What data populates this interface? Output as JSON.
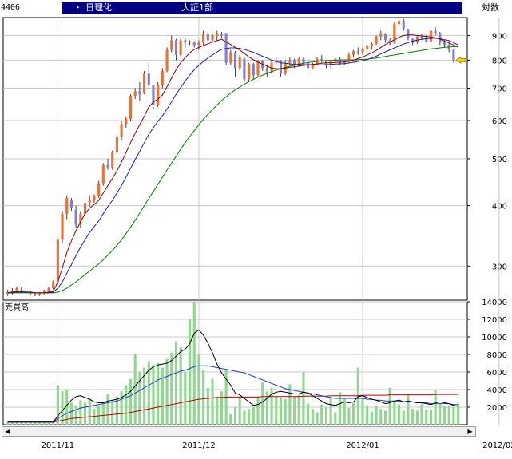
{
  "header": {
    "code": "4406",
    "dot": "・",
    "name": "日理化",
    "market": "大証1部",
    "scale_button": "対数"
  },
  "colors": {
    "up_candle": "#f07030",
    "down_candle": "#8080d0",
    "volume": "#90d890",
    "ma_short": "#8b0000",
    "ma_mid": "#2020a0",
    "ma_long": "#008000",
    "vol_ma_short": "#000000",
    "vol_ma_mid": "#2040c0",
    "vol_ma_long": "#c00000",
    "header_bg": "#000080"
  },
  "chart_data": [
    {
      "type": "candlestick",
      "scale": "log",
      "ylim": [
        255,
        980
      ],
      "yticks": [
        300,
        400,
        500,
        600,
        700,
        800,
        900
      ],
      "grid": true,
      "x_labels": [
        {
          "index": 11,
          "label": "2011/11"
        },
        {
          "index": 42,
          "label": "2011/12"
        },
        {
          "index": 78,
          "label": "2012/01"
        },
        {
          "index": 108,
          "label": "2012/02"
        }
      ],
      "candles": [
        [
          263,
          268,
          260,
          265
        ],
        [
          265,
          270,
          262,
          266
        ],
        [
          266,
          272,
          264,
          270
        ],
        [
          268,
          271,
          264,
          265
        ],
        [
          265,
          268,
          262,
          264
        ],
        [
          264,
          266,
          261,
          263
        ],
        [
          263,
          265,
          260,
          262
        ],
        [
          262,
          265,
          260,
          264
        ],
        [
          264,
          268,
          262,
          266
        ],
        [
          266,
          272,
          264,
          270
        ],
        [
          270,
          280,
          268,
          278
        ],
        [
          278,
          345,
          276,
          340
        ],
        [
          340,
          390,
          335,
          385
        ],
        [
          385,
          420,
          375,
          415
        ],
        [
          410,
          415,
          390,
          395
        ],
        [
          392,
          400,
          360,
          365
        ],
        [
          365,
          390,
          360,
          385
        ],
        [
          385,
          410,
          380,
          405
        ],
        [
          405,
          420,
          398,
          412
        ],
        [
          410,
          422,
          405,
          418
        ],
        [
          418,
          450,
          415,
          445
        ],
        [
          445,
          490,
          440,
          485
        ],
        [
          485,
          500,
          475,
          480
        ],
        [
          480,
          520,
          475,
          515
        ],
        [
          515,
          560,
          505,
          555
        ],
        [
          555,
          600,
          545,
          590
        ],
        [
          590,
          610,
          580,
          605
        ],
        [
          605,
          680,
          600,
          675
        ],
        [
          675,
          700,
          665,
          690
        ],
        [
          690,
          720,
          660,
          680
        ],
        [
          685,
          760,
          680,
          750
        ],
        [
          750,
          790,
          700,
          710
        ],
        [
          710,
          640,
          635,
          645
        ],
        [
          645,
          720,
          640,
          710
        ],
        [
          710,
          770,
          700,
          760
        ],
        [
          760,
          850,
          755,
          840
        ],
        [
          840,
          900,
          830,
          880
        ],
        [
          880,
          885,
          800,
          820
        ],
        [
          820,
          890,
          815,
          880
        ],
        [
          880,
          890,
          850,
          870
        ],
        [
          870,
          880,
          860,
          875
        ],
        [
          870,
          875,
          850,
          860
        ],
        [
          860,
          880,
          840,
          870
        ],
        [
          870,
          920,
          860,
          910
        ],
        [
          905,
          915,
          870,
          880
        ],
        [
          880,
          910,
          870,
          900
        ],
        [
          900,
          920,
          880,
          910
        ],
        [
          905,
          915,
          890,
          900
        ],
        [
          910,
          905,
          780,
          790
        ],
        [
          790,
          840,
          780,
          830
        ],
        [
          830,
          835,
          740,
          770
        ],
        [
          770,
          820,
          760,
          810
        ],
        [
          805,
          810,
          720,
          730
        ],
        [
          730,
          790,
          725,
          785
        ],
        [
          785,
          790,
          730,
          745
        ],
        [
          745,
          800,
          740,
          795
        ],
        [
          795,
          800,
          760,
          770
        ],
        [
          770,
          780,
          740,
          755
        ],
        [
          755,
          800,
          750,
          790
        ],
        [
          790,
          810,
          780,
          800
        ],
        [
          795,
          800,
          740,
          750
        ],
        [
          750,
          800,
          745,
          790
        ],
        [
          790,
          810,
          780,
          800
        ],
        [
          800,
          805,
          770,
          780
        ],
        [
          780,
          810,
          775,
          805
        ],
        [
          805,
          810,
          780,
          790
        ],
        [
          790,
          800,
          760,
          770
        ],
        [
          770,
          790,
          765,
          785
        ],
        [
          785,
          810,
          780,
          805
        ],
        [
          805,
          820,
          790,
          800
        ],
        [
          800,
          800,
          770,
          780
        ],
        [
          780,
          800,
          770,
          795
        ],
        [
          795,
          810,
          790,
          805
        ],
        [
          805,
          810,
          780,
          785
        ],
        [
          785,
          800,
          780,
          795
        ],
        [
          795,
          830,
          790,
          820
        ],
        [
          820,
          840,
          810,
          835
        ],
        [
          835,
          850,
          820,
          830
        ],
        [
          830,
          850,
          820,
          845
        ],
        [
          845,
          860,
          835,
          855
        ],
        [
          855,
          870,
          845,
          865
        ],
        [
          865,
          900,
          860,
          895
        ],
        [
          895,
          920,
          880,
          910
        ],
        [
          905,
          910,
          870,
          880
        ],
        [
          880,
          890,
          860,
          870
        ],
        [
          870,
          960,
          865,
          950
        ],
        [
          950,
          975,
          935,
          965
        ],
        [
          965,
          975,
          920,
          930
        ],
        [
          925,
          930,
          880,
          890
        ],
        [
          885,
          890,
          860,
          870
        ],
        [
          870,
          900,
          865,
          895
        ],
        [
          895,
          905,
          880,
          890
        ],
        [
          890,
          900,
          870,
          875
        ],
        [
          875,
          930,
          870,
          920
        ],
        [
          920,
          935,
          900,
          910
        ],
        [
          910,
          915,
          860,
          870
        ],
        [
          870,
          880,
          850,
          860
        ],
        [
          860,
          870,
          830,
          840
        ],
        [
          840,
          845,
          790,
          800
        ],
        [
          800,
          810,
          795,
          805
        ]
      ],
      "ma_short": [
        264,
        265,
        266,
        266,
        265,
        265,
        264,
        264,
        264,
        265,
        266,
        278,
        297,
        320,
        338,
        355,
        370,
        385,
        395,
        402,
        410,
        425,
        440,
        455,
        472,
        492,
        515,
        540,
        565,
        588,
        612,
        640,
        655,
        665,
        678,
        705,
        735,
        765,
        790,
        810,
        828,
        842,
        850,
        858,
        865,
        872,
        878,
        884,
        872,
        862,
        850,
        840,
        826,
        812,
        802,
        792,
        785,
        778,
        770,
        768,
        768,
        770,
        773,
        775,
        778,
        780,
        782,
        784,
        786,
        788,
        790,
        790,
        791,
        792,
        793,
        796,
        800,
        806,
        812,
        820,
        828,
        838,
        850,
        862,
        872,
        882,
        892,
        900,
        902,
        902,
        900,
        898,
        896,
        894,
        890,
        884,
        876,
        868,
        860,
        852
      ],
      "ma_mid": [
        264,
        264,
        265,
        265,
        265,
        265,
        264,
        264,
        264,
        264,
        265,
        270,
        278,
        290,
        302,
        315,
        328,
        340,
        352,
        362,
        372,
        385,
        398,
        410,
        425,
        440,
        458,
        478,
        498,
        518,
        540,
        562,
        580,
        598,
        614,
        634,
        656,
        680,
        702,
        724,
        745,
        764,
        780,
        795,
        808,
        820,
        832,
        842,
        846,
        848,
        848,
        846,
        842,
        836,
        830,
        822,
        815,
        808,
        800,
        795,
        790,
        788,
        786,
        784,
        784,
        783,
        783,
        782,
        782,
        782,
        783,
        784,
        785,
        786,
        787,
        789,
        792,
        795,
        798,
        802,
        808,
        815,
        824,
        832,
        840,
        848,
        856,
        864,
        870,
        876,
        880,
        884,
        886,
        888,
        888,
        886,
        882,
        878,
        870,
        860
      ],
      "ma_long": [
        264,
        264,
        264,
        264,
        264,
        264,
        264,
        264,
        264,
        264,
        264,
        265,
        267,
        270,
        274,
        278,
        283,
        288,
        293,
        298,
        303,
        309,
        316,
        323,
        331,
        340,
        350,
        361,
        373,
        386,
        400,
        414,
        428,
        443,
        458,
        474,
        490,
        506,
        523,
        540,
        556,
        572,
        588,
        604,
        618,
        632,
        646,
        660,
        672,
        684,
        694,
        704,
        713,
        722,
        730,
        738,
        745,
        751,
        757,
        763,
        768,
        773,
        777,
        781,
        785,
        788,
        791,
        793,
        795,
        797,
        798,
        799,
        800,
        800,
        801,
        801,
        801,
        802,
        803,
        804,
        806,
        808,
        811,
        814,
        817,
        820,
        823,
        826,
        829,
        832,
        835,
        838,
        841,
        844,
        846,
        848,
        850,
        852,
        853,
        854
      ],
      "last_price": 800
    },
    {
      "type": "bar",
      "title": "売買高",
      "ylim": [
        0,
        14000
      ],
      "yticks": [
        2000,
        4000,
        6000,
        8000,
        10000,
        12000,
        14000
      ],
      "grid": true,
      "values": [
        300,
        300,
        300,
        300,
        300,
        300,
        300,
        300,
        300,
        300,
        300,
        4500,
        3800,
        4000,
        2500,
        2200,
        2800,
        2500,
        3000,
        1800,
        2200,
        2600,
        3500,
        2800,
        3200,
        3800,
        4500,
        5200,
        8000,
        6000,
        6500,
        7200,
        6800,
        7000,
        6500,
        7500,
        8200,
        9500,
        8800,
        6000,
        12000,
        14000,
        8000,
        6200,
        4200,
        5200,
        3200,
        3800,
        6300,
        1200,
        2000,
        3200,
        1600,
        1800,
        2000,
        3200,
        4800,
        3800,
        4200,
        3200,
        3100,
        2900,
        4600,
        3200,
        3400,
        6000,
        2400,
        1800,
        1400,
        2300,
        2000,
        3100,
        1400,
        3700,
        3100,
        1900,
        2500,
        6500,
        3100,
        2200,
        1500,
        2200,
        1800,
        1600,
        4200,
        2700,
        2300,
        1600,
        3500,
        1800,
        1600,
        2400,
        1700,
        1700,
        3900,
        2400,
        2100,
        2200,
        2000,
        2400
      ],
      "ma_short": [
        300,
        300,
        300,
        300,
        300,
        300,
        300,
        300,
        300,
        300,
        300,
        1000,
        1600,
        2200,
        2800,
        3200,
        3300,
        3100,
        2900,
        2600,
        2500,
        2500,
        2700,
        2800,
        2900,
        3100,
        3400,
        3800,
        4400,
        5000,
        5600,
        6200,
        6600,
        6800,
        6900,
        7000,
        7300,
        7800,
        8300,
        8600,
        9200,
        10400,
        10800,
        10200,
        9300,
        8200,
        6900,
        5900,
        5200,
        4500,
        3600,
        3400,
        3000,
        2600,
        2200,
        2300,
        2600,
        3000,
        3500,
        3700,
        3800,
        3700,
        3600,
        3500,
        3500,
        3700,
        3600,
        3300,
        3000,
        2700,
        2400,
        2300,
        2200,
        2400,
        2600,
        2500,
        2600,
        3200,
        3300,
        3100,
        2900,
        2800,
        2600,
        2400,
        2500,
        2700,
        2800,
        2600,
        2700,
        2600,
        2500,
        2500,
        2400,
        2300,
        2500,
        2600,
        2500,
        2400,
        2200,
        2100
      ],
      "ma_mid": [
        300,
        300,
        300,
        300,
        300,
        300,
        300,
        300,
        300,
        300,
        300,
        700,
        1000,
        1300,
        1500,
        1700,
        1900,
        2000,
        2100,
        2200,
        2300,
        2400,
        2500,
        2600,
        2700,
        2900,
        3100,
        3300,
        3600,
        3900,
        4200,
        4500,
        4800,
        5100,
        5300,
        5500,
        5700,
        5900,
        6100,
        6200,
        6400,
        6600,
        6700,
        6700,
        6700,
        6600,
        6500,
        6400,
        6300,
        6200,
        6100,
        6000,
        5900,
        5700,
        5500,
        5300,
        5100,
        4900,
        4700,
        4500,
        4300,
        4100,
        4000,
        3900,
        3800,
        3700,
        3600,
        3500,
        3400,
        3300,
        3200,
        3100,
        3000,
        3000,
        3000,
        3000,
        3000,
        3000,
        3000,
        2900,
        2900,
        2800,
        2800,
        2700,
        2700,
        2700,
        2700,
        2600,
        2600,
        2600,
        2500,
        2500,
        2500,
        2400,
        2400,
        2400,
        2400,
        2400,
        2300,
        2300
      ],
      "ma_long": [
        300,
        300,
        300,
        300,
        300,
        300,
        300,
        300,
        300,
        300,
        300,
        400,
        500,
        600,
        700,
        750,
        800,
        850,
        900,
        950,
        1000,
        1050,
        1100,
        1150,
        1200,
        1250,
        1300,
        1400,
        1500,
        1600,
        1700,
        1800,
        1900,
        2000,
        2100,
        2200,
        2300,
        2400,
        2500,
        2600,
        2700,
        2800,
        2900,
        2950,
        3000,
        3050,
        3100,
        3100,
        3150,
        3150,
        3150,
        3150,
        3150,
        3150,
        3150,
        3150,
        3200,
        3200,
        3200,
        3200,
        3200,
        3200,
        3200,
        3200,
        3200,
        3250,
        3250,
        3250,
        3250,
        3250,
        3250,
        3300,
        3300,
        3300,
        3300,
        3300,
        3300,
        3300,
        3350,
        3350,
        3350,
        3350,
        3350,
        3350,
        3400,
        3400,
        3400,
        3400,
        3400,
        3400,
        3400,
        3400,
        3400,
        3400,
        3450,
        3450,
        3450,
        3450,
        3450,
        3450
      ]
    }
  ]
}
